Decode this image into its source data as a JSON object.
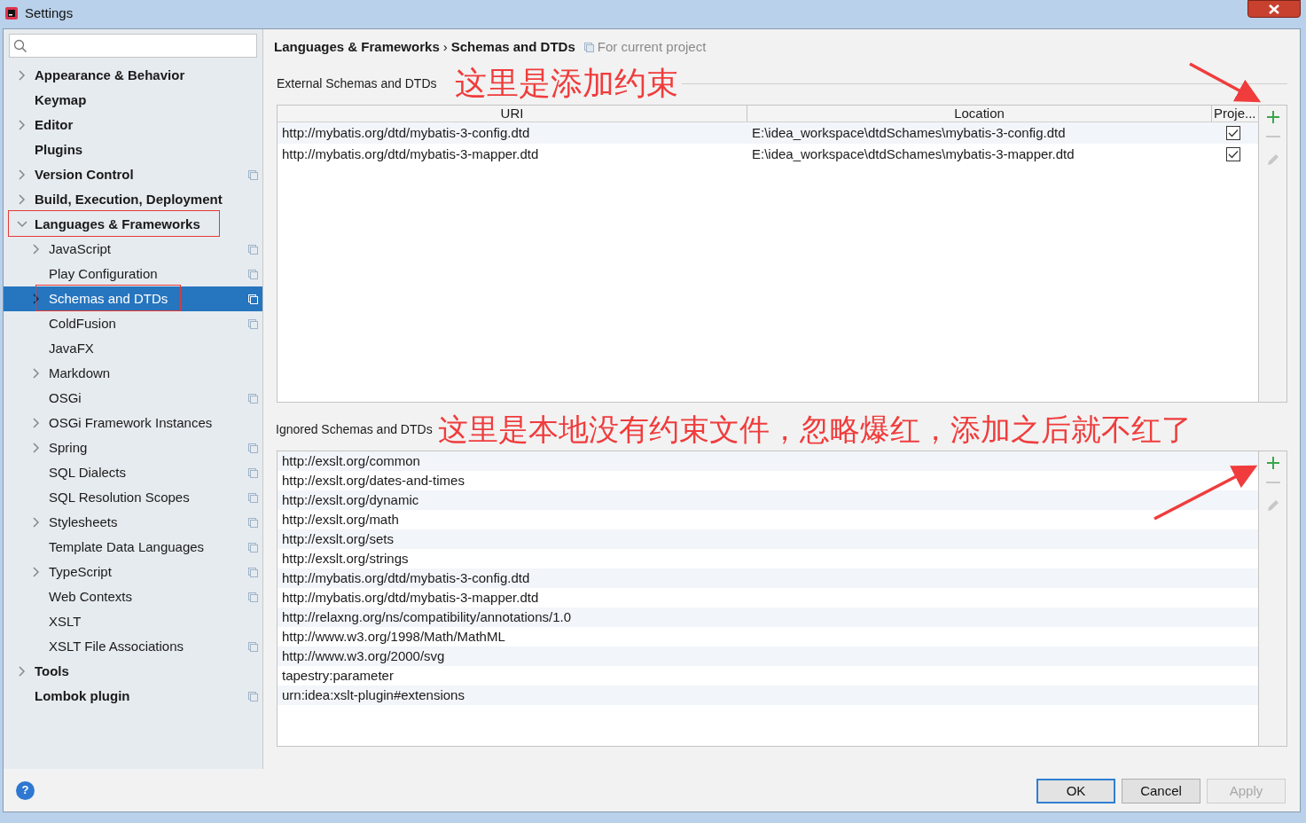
{
  "window": {
    "title": "Settings"
  },
  "sidebar": {
    "items": [
      {
        "label": "Appearance & Behavior",
        "kind": "group",
        "expanded": false,
        "selected": false,
        "project_scoped": false,
        "outlined": false
      },
      {
        "label": "Keymap",
        "kind": "leaf",
        "selected": false,
        "project_scoped": false,
        "outlined": false
      },
      {
        "label": "Editor",
        "kind": "group",
        "expanded": false,
        "selected": false,
        "project_scoped": false,
        "outlined": false
      },
      {
        "label": "Plugins",
        "kind": "leaf",
        "selected": false,
        "project_scoped": false,
        "outlined": false
      },
      {
        "label": "Version Control",
        "kind": "group",
        "expanded": false,
        "selected": false,
        "project_scoped": true,
        "outlined": false
      },
      {
        "label": "Build, Execution, Deployment",
        "kind": "group",
        "expanded": false,
        "selected": false,
        "project_scoped": false,
        "outlined": false
      },
      {
        "label": "Languages & Frameworks",
        "kind": "group",
        "expanded": true,
        "selected": false,
        "project_scoped": false,
        "outlined": true,
        "children": [
          {
            "label": "JavaScript",
            "kind": "group",
            "expanded": false,
            "selected": false,
            "project_scoped": true,
            "outlined": false
          },
          {
            "label": "Play Configuration",
            "kind": "leaf",
            "selected": false,
            "project_scoped": true,
            "outlined": false
          },
          {
            "label": "Schemas and DTDs",
            "kind": "group",
            "expanded": false,
            "selected": true,
            "project_scoped": true,
            "outlined": true
          },
          {
            "label": "ColdFusion",
            "kind": "leaf",
            "selected": false,
            "project_scoped": true,
            "outlined": false
          },
          {
            "label": "JavaFX",
            "kind": "leaf",
            "selected": false,
            "project_scoped": false,
            "outlined": false
          },
          {
            "label": "Markdown",
            "kind": "group",
            "expanded": false,
            "selected": false,
            "project_scoped": false,
            "outlined": false
          },
          {
            "label": "OSGi",
            "kind": "leaf",
            "selected": false,
            "project_scoped": true,
            "outlined": false
          },
          {
            "label": "OSGi Framework Instances",
            "kind": "group",
            "expanded": false,
            "selected": false,
            "project_scoped": false,
            "outlined": false
          },
          {
            "label": "Spring",
            "kind": "group",
            "expanded": false,
            "selected": false,
            "project_scoped": true,
            "outlined": false
          },
          {
            "label": "SQL Dialects",
            "kind": "leaf",
            "selected": false,
            "project_scoped": true,
            "outlined": false
          },
          {
            "label": "SQL Resolution Scopes",
            "kind": "leaf",
            "selected": false,
            "project_scoped": true,
            "outlined": false
          },
          {
            "label": "Stylesheets",
            "kind": "group",
            "expanded": false,
            "selected": false,
            "project_scoped": true,
            "outlined": false
          },
          {
            "label": "Template Data Languages",
            "kind": "leaf",
            "selected": false,
            "project_scoped": true,
            "outlined": false
          },
          {
            "label": "TypeScript",
            "kind": "group",
            "expanded": false,
            "selected": false,
            "project_scoped": true,
            "outlined": false
          },
          {
            "label": "Web Contexts",
            "kind": "leaf",
            "selected": false,
            "project_scoped": true,
            "outlined": false
          },
          {
            "label": "XSLT",
            "kind": "leaf",
            "selected": false,
            "project_scoped": false,
            "outlined": false
          },
          {
            "label": "XSLT File Associations",
            "kind": "leaf",
            "selected": false,
            "project_scoped": true,
            "outlined": false
          }
        ]
      },
      {
        "label": "Tools",
        "kind": "group",
        "expanded": false,
        "selected": false,
        "project_scoped": false,
        "outlined": false
      },
      {
        "label": "Lombok plugin",
        "kind": "leaf",
        "selected": false,
        "project_scoped": true,
        "outlined": false
      }
    ]
  },
  "breadcrumb": {
    "parent": "Languages & Frameworks",
    "separator": "›",
    "current": "Schemas and DTDs",
    "scope": "For current project"
  },
  "external": {
    "label": "External Schemas and DTDs",
    "annotation": "这里是添加约束",
    "columns": [
      "URI",
      "Location",
      "Proje..."
    ],
    "rows": [
      {
        "uri": "http://mybatis.org/dtd/mybatis-3-config.dtd",
        "location": "E:\\idea_workspace\\dtdSchames\\mybatis-3-config.dtd",
        "checked": true
      },
      {
        "uri": "http://mybatis.org/dtd/mybatis-3-mapper.dtd",
        "location": "E:\\idea_workspace\\dtdSchames\\mybatis-3-mapper.dtd",
        "checked": true
      }
    ]
  },
  "ignored": {
    "label": "Ignored Schemas and DTDs",
    "annotation": "这里是本地没有约束文件，忽略爆红，添加之后就不红了",
    "rows": [
      "http://exslt.org/common",
      "http://exslt.org/dates-and-times",
      "http://exslt.org/dynamic",
      "http://exslt.org/math",
      "http://exslt.org/sets",
      "http://exslt.org/strings",
      "http://mybatis.org/dtd/mybatis-3-config.dtd",
      "http://mybatis.org/dtd/mybatis-3-mapper.dtd",
      "http://relaxng.org/ns/compatibility/annotations/1.0",
      "http://www.w3.org/1998/Math/MathML",
      "http://www.w3.org/2000/svg",
      "tapestry:parameter",
      "urn:idea:xslt-plugin#extensions"
    ]
  },
  "help": {
    "label": "?"
  },
  "buttons": [
    {
      "label": "OK",
      "kind": "default",
      "disabled": false
    },
    {
      "label": "Cancel",
      "kind": "normal",
      "disabled": false
    },
    {
      "label": "Apply",
      "kind": "normal",
      "disabled": true
    }
  ]
}
